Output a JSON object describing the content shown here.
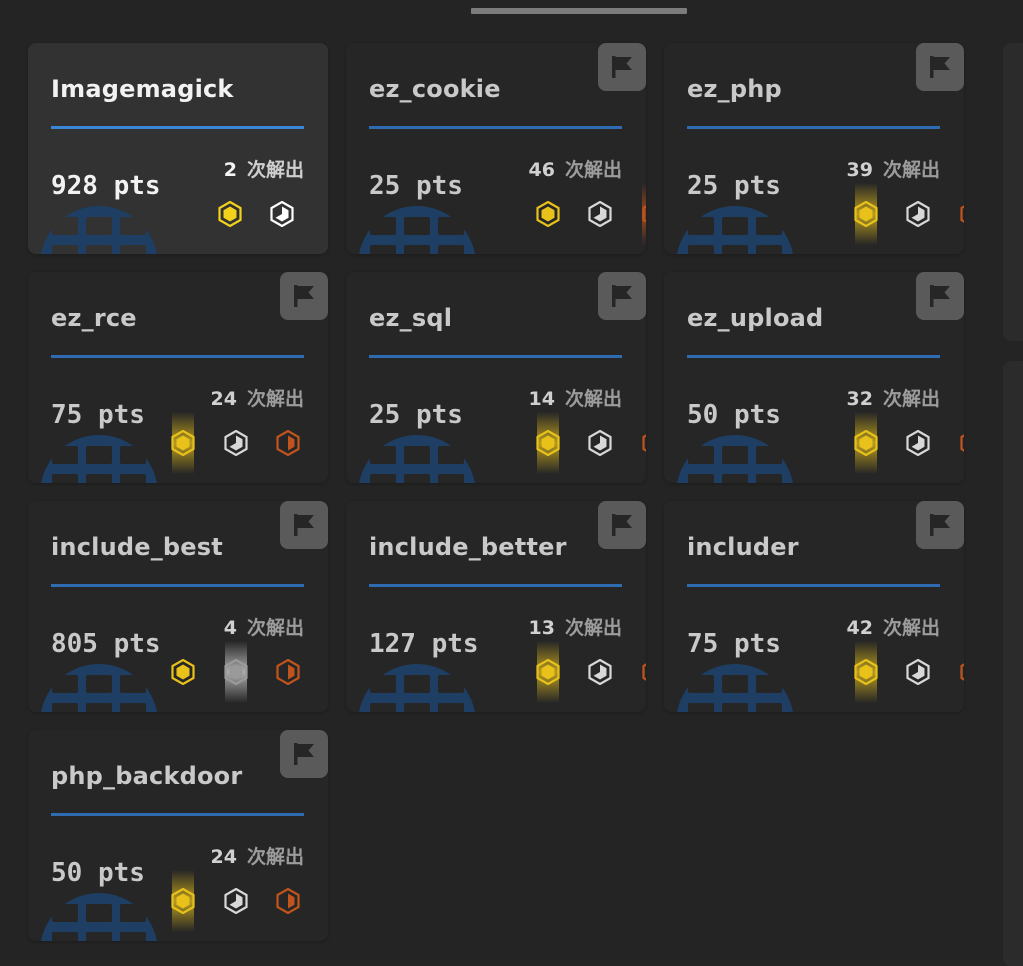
{
  "solves_suffix": "次解出",
  "points_unit": "pts",
  "colors": {
    "accent_blue": "#2f6bb1",
    "gold": "#e8c21a",
    "silver": "#d8d8d8",
    "bronze": "#c0541c",
    "flag_badge": "#5a5a5a"
  },
  "icons": {
    "flag": "flag-icon",
    "globe": "globe-icon",
    "gold_medal": "gold-blood-icon",
    "silver_medal": "silver-blood-icon",
    "bronze_medal": "bronze-blood-icon"
  },
  "challenges": [
    {
      "name": "Imagemagick",
      "points": "928 pts",
      "solves": "2",
      "solved": true
    },
    {
      "name": "ez_cookie",
      "points": "25 pts",
      "solves": "46",
      "solved": false
    },
    {
      "name": "ez_php",
      "points": "25 pts",
      "solves": "39",
      "solved": false
    },
    {
      "name": "ez_rce",
      "points": "75 pts",
      "solves": "24",
      "solved": false
    },
    {
      "name": "ez_sql",
      "points": "25 pts",
      "solves": "14",
      "solved": false
    },
    {
      "name": "ez_upload",
      "points": "50 pts",
      "solves": "32",
      "solved": false
    },
    {
      "name": "include_best",
      "points": "805 pts",
      "solves": "4",
      "solved": false
    },
    {
      "name": "include_better",
      "points": "127 pts",
      "solves": "13",
      "solved": false
    },
    {
      "name": "includer",
      "points": "75 pts",
      "solves": "42",
      "solved": false
    },
    {
      "name": "php_backdoor",
      "points": "50 pts",
      "solves": "24",
      "solved": false
    }
  ]
}
